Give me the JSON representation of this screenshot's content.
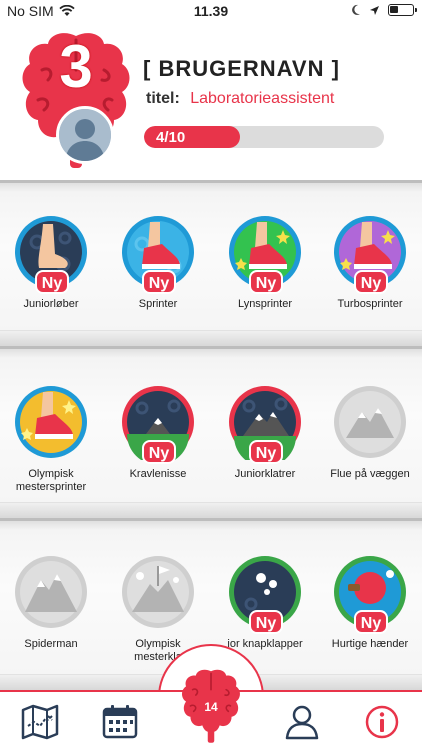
{
  "status_bar": {
    "carrier": "No SIM",
    "time": "11.39"
  },
  "profile": {
    "level": "3",
    "username": "[ BRUGERNAVN ]",
    "title_label": "titel:",
    "title_value": "Laboratorieassistent",
    "progress_text": "4/10",
    "progress_fraction": 0.4
  },
  "new_label": "Ny",
  "shelves": [
    {
      "badges": [
        {
          "name": "Juniorløber",
          "new": true
        },
        {
          "name": "Sprinter",
          "new": true
        },
        {
          "name": "Lynsprinter",
          "new": true
        },
        {
          "name": "Turbosprinter",
          "new": true
        }
      ]
    },
    {
      "badges": [
        {
          "name": "Olympisk mestersprinter",
          "new": false
        },
        {
          "name": "Kravlenisse",
          "new": true
        },
        {
          "name": "Juniorklatrer",
          "new": true
        },
        {
          "name": "Flue på væggen",
          "new": false
        }
      ]
    },
    {
      "badges": [
        {
          "name": "Spiderman",
          "new": false
        },
        {
          "name": "Olympisk mesterkla",
          "new": false
        },
        {
          "name": "ior knapklapper",
          "new": true
        },
        {
          "name": "Hurtige hænder",
          "new": true
        }
      ]
    }
  ],
  "tabbar": {
    "center_count": "14"
  },
  "colors": {
    "accent": "#e8344a",
    "blue_ring": "#1f9ad6",
    "grey_badge": "#cfcfcf"
  }
}
